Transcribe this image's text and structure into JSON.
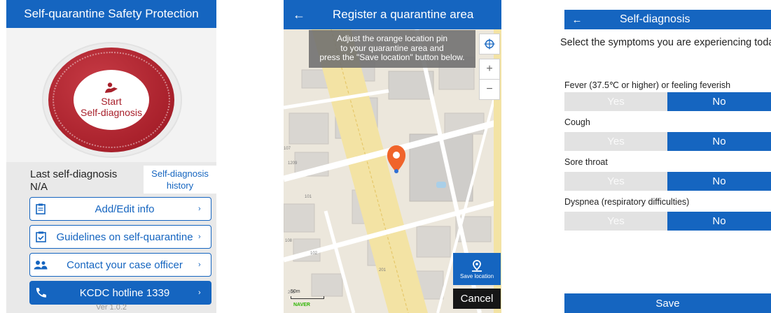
{
  "colors": {
    "primary_blue": "#1565c0",
    "start_red": "#a8202b",
    "map_pin": "#f0642a",
    "yes_inactive": "#e2e2e2"
  },
  "screen1": {
    "header_title": "Self-quarantine Safety Protection",
    "start_line1": "Start",
    "start_line2": "Self-diagnosis",
    "start_icon": "doctor-icon",
    "last_diagnosis_label": "Last self-diagnosis",
    "last_diagnosis_value": "N/A",
    "history_line1": "Self-diagnosis",
    "history_line2": "history",
    "menu": [
      {
        "label": "Add/Edit info",
        "icon": "clipboard-icon"
      },
      {
        "label": "Guidelines on self-quarantine",
        "icon": "checklist-icon"
      },
      {
        "label": "Contact your case officer",
        "icon": "people-icon"
      },
      {
        "label": "KCDC hotline 1339",
        "icon": "phone-icon"
      }
    ],
    "version": "Ver 1.0.2"
  },
  "screen2": {
    "header_title": "Register a quarantine area",
    "banner_line1": "Adjust the orange location pin",
    "banner_line2": "to your quarantine area and",
    "banner_line3": "press the \"Save location\" button below.",
    "zoom_in": "+",
    "zoom_out": "−",
    "save_location_label": "Save location",
    "cancel_label": "Cancel",
    "map_brand": "NAVER",
    "scale_label": "50m",
    "map_numbers": [
      "1209",
      "101",
      "108",
      "102",
      "201",
      "203",
      "107"
    ]
  },
  "screen3": {
    "header_title": "Self-diagnosis",
    "prompt": "Select the symptoms you are experiencing today",
    "questions": [
      {
        "label": "Fever (37.5℃ or higher) or feeling feverish",
        "yes": "Yes",
        "no": "No"
      },
      {
        "label": "Cough",
        "yes": "Yes",
        "no": "No"
      },
      {
        "label": "Sore throat",
        "yes": "Yes",
        "no": "No"
      },
      {
        "label": "Dyspnea (respiratory difficulties)",
        "yes": "Yes",
        "no": "No"
      }
    ],
    "save_label": "Save"
  }
}
